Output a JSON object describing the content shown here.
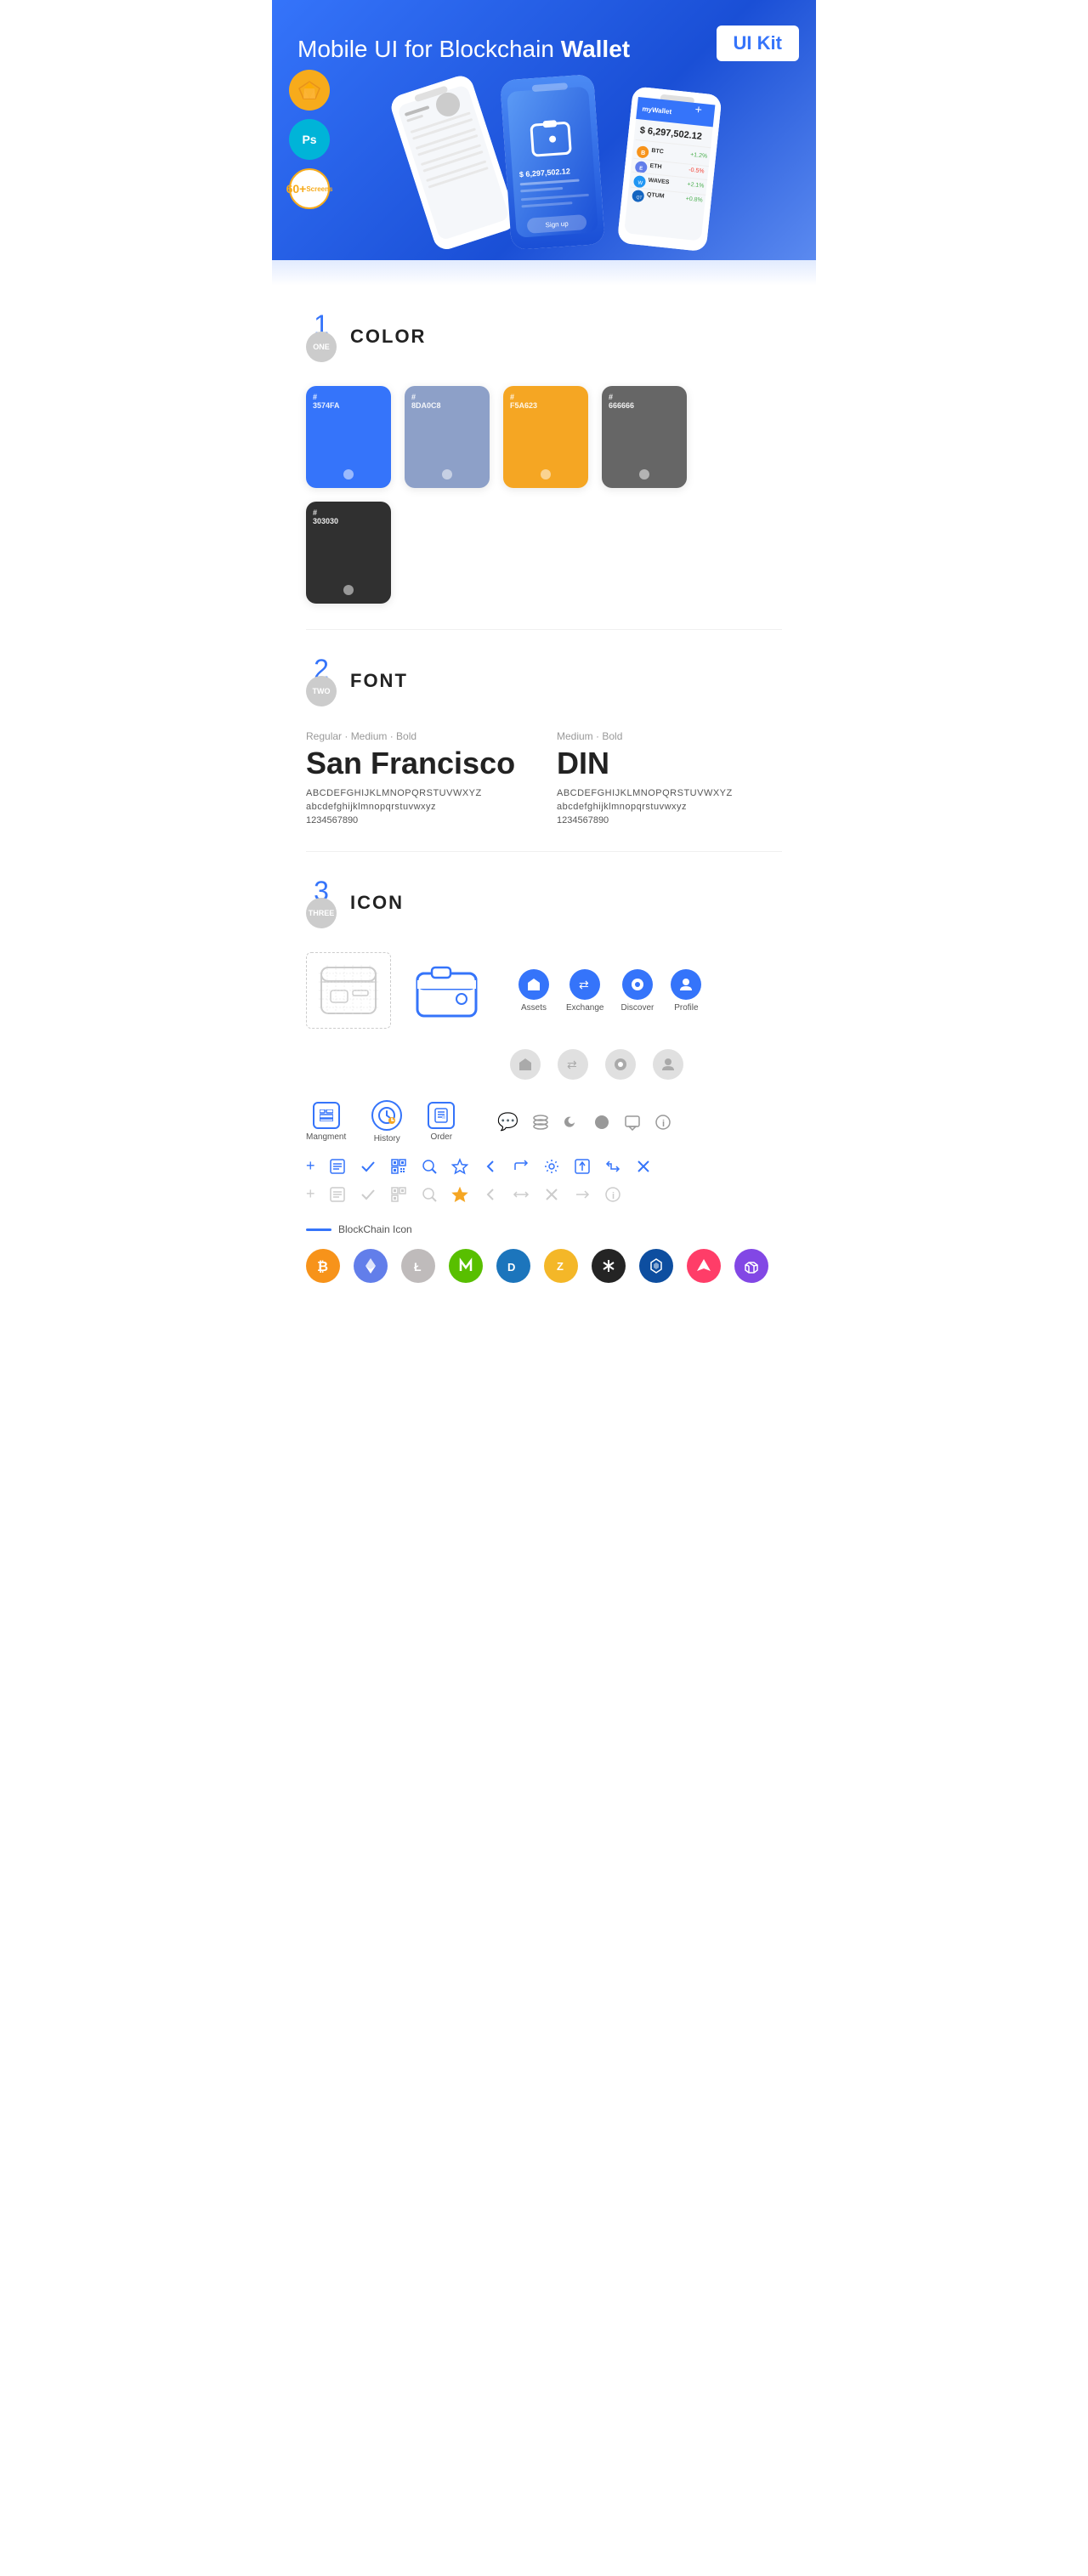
{
  "hero": {
    "title_normal": "Mobile UI for Blockchain ",
    "title_bold": "Wallet",
    "badge": "UI Kit",
    "badges": [
      {
        "type": "sketch",
        "label": "Sketch"
      },
      {
        "type": "ps",
        "label": "Ps"
      },
      {
        "type": "screens",
        "count": "60+",
        "label": "Screens"
      }
    ]
  },
  "sections": {
    "color": {
      "number": "1",
      "sublabel": "ONE",
      "title": "COLOR",
      "swatches": [
        {
          "hex": "#3574FA",
          "code": "#3574FA",
          "name": "Blue"
        },
        {
          "hex": "#8DA0C8",
          "code": "#8DA0C8",
          "name": "Slate Blue"
        },
        {
          "hex": "#F5A623",
          "code": "#F5A623",
          "name": "Orange"
        },
        {
          "hex": "#666666",
          "code": "#666666",
          "name": "Gray"
        },
        {
          "hex": "#303030",
          "code": "#303030",
          "name": "Dark"
        }
      ]
    },
    "font": {
      "number": "2",
      "sublabel": "TWO",
      "title": "FONT",
      "fonts": [
        {
          "weights": "Regular · Medium · Bold",
          "name": "San Francisco",
          "alphabet_upper": "ABCDEFGHIJKLMNOPQRSTUVWXYZ",
          "alphabet_lower": "abcdefghijklmnopqrstuvwxyz",
          "numbers": "1234567890"
        },
        {
          "weights": "Medium · Bold",
          "name": "DIN",
          "alphabet_upper": "ABCDEFGHIJKLMNOPQRSTUVWXYZ",
          "alphabet_lower": "abcdefghijklmnopqrstuvwxyz",
          "numbers": "1234567890"
        }
      ]
    },
    "icon": {
      "number": "3",
      "sublabel": "THREE",
      "title": "ICON",
      "nav_items": [
        {
          "label": "Assets",
          "icon": "◆"
        },
        {
          "label": "Exchange",
          "icon": "⇄"
        },
        {
          "label": "Discover",
          "icon": "●"
        },
        {
          "label": "Profile",
          "icon": "👤"
        }
      ],
      "app_icons": [
        {
          "label": "Mangment",
          "icon": "⊞"
        },
        {
          "label": "History",
          "icon": "🕐"
        },
        {
          "label": "Order",
          "icon": "📋"
        }
      ],
      "misc_icons": [
        "💬",
        "≡",
        "◑",
        "●",
        "💬",
        "ℹ"
      ],
      "tool_icons_active": [
        "+",
        "📋",
        "✓",
        "⊞",
        "🔍",
        "☆",
        "<",
        "<",
        "⚙",
        "⬜",
        "⇄",
        "✕"
      ],
      "tool_icons_inactive": [
        "+",
        "📋",
        "✓",
        "⊞",
        "🔍",
        "☆",
        "<",
        "↔",
        "✕",
        "→",
        "ℹ"
      ],
      "blockchain_label": "BlockChain Icon",
      "crypto_coins": [
        {
          "name": "Bitcoin",
          "color": "#F7931A",
          "symbol": "₿"
        },
        {
          "name": "Ethereum",
          "color": "#627EEA",
          "symbol": "⬡"
        },
        {
          "name": "Litecoin",
          "color": "#BFBBBB",
          "symbol": "Ł"
        },
        {
          "name": "NEO",
          "color": "#58BF00",
          "symbol": "N"
        },
        {
          "name": "Dash",
          "color": "#1C75BC",
          "symbol": "D"
        },
        {
          "name": "Zcash",
          "color": "#F4B728",
          "symbol": "Z"
        },
        {
          "name": "IOTA",
          "color": "#242424",
          "symbol": "●"
        },
        {
          "name": "Lisk",
          "color": "#0D4EA0",
          "symbol": "L"
        },
        {
          "name": "Ark",
          "color": "#FF3D68",
          "symbol": "A"
        },
        {
          "name": "Polygon",
          "color": "#8247E5",
          "symbol": "⬡"
        }
      ]
    }
  }
}
